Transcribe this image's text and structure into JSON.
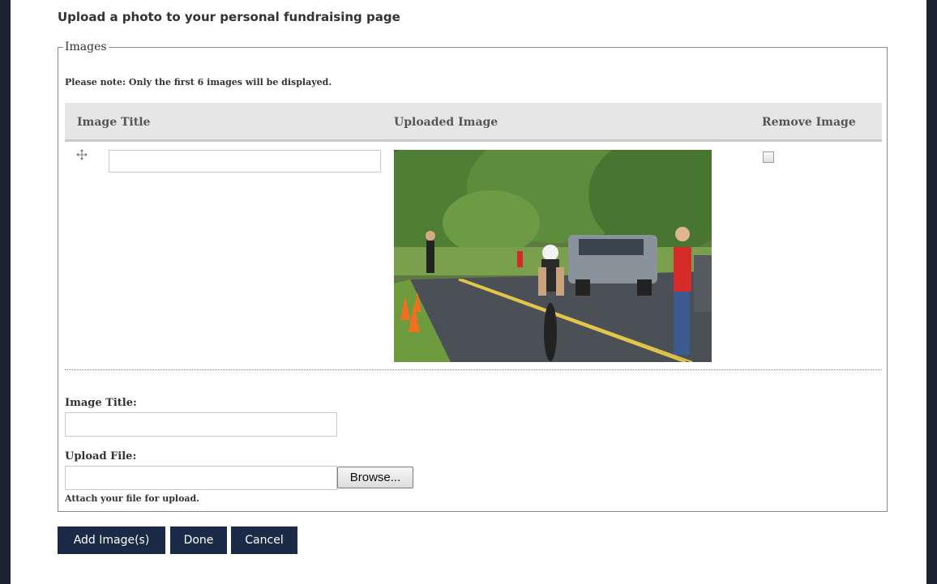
{
  "page": {
    "heading": "Upload a photo to your personal fundraising page"
  },
  "images_section": {
    "legend": "Images",
    "note": "Please note: Only the first 6 images will be displayed.",
    "columns": [
      "Image Title",
      "Uploaded Image",
      "Remove Image"
    ],
    "rows": [
      {
        "title_value": "",
        "image": "cyclist-race-photo",
        "remove_checked": false
      }
    ]
  },
  "upload_form": {
    "image_title_label": "Image Title:",
    "image_title_value": "",
    "upload_file_label": "Upload File:",
    "upload_file_value": "",
    "browse_label": "Browse...",
    "hint": "Attach your file for upload."
  },
  "actions": {
    "add_label": "Add Image(s)",
    "done_label": "Done",
    "cancel_label": "Cancel"
  },
  "colors": {
    "background": "#1c2330",
    "panel": "#ffffff",
    "button": "#1b2b47",
    "table_header": "#e6e6e6"
  }
}
